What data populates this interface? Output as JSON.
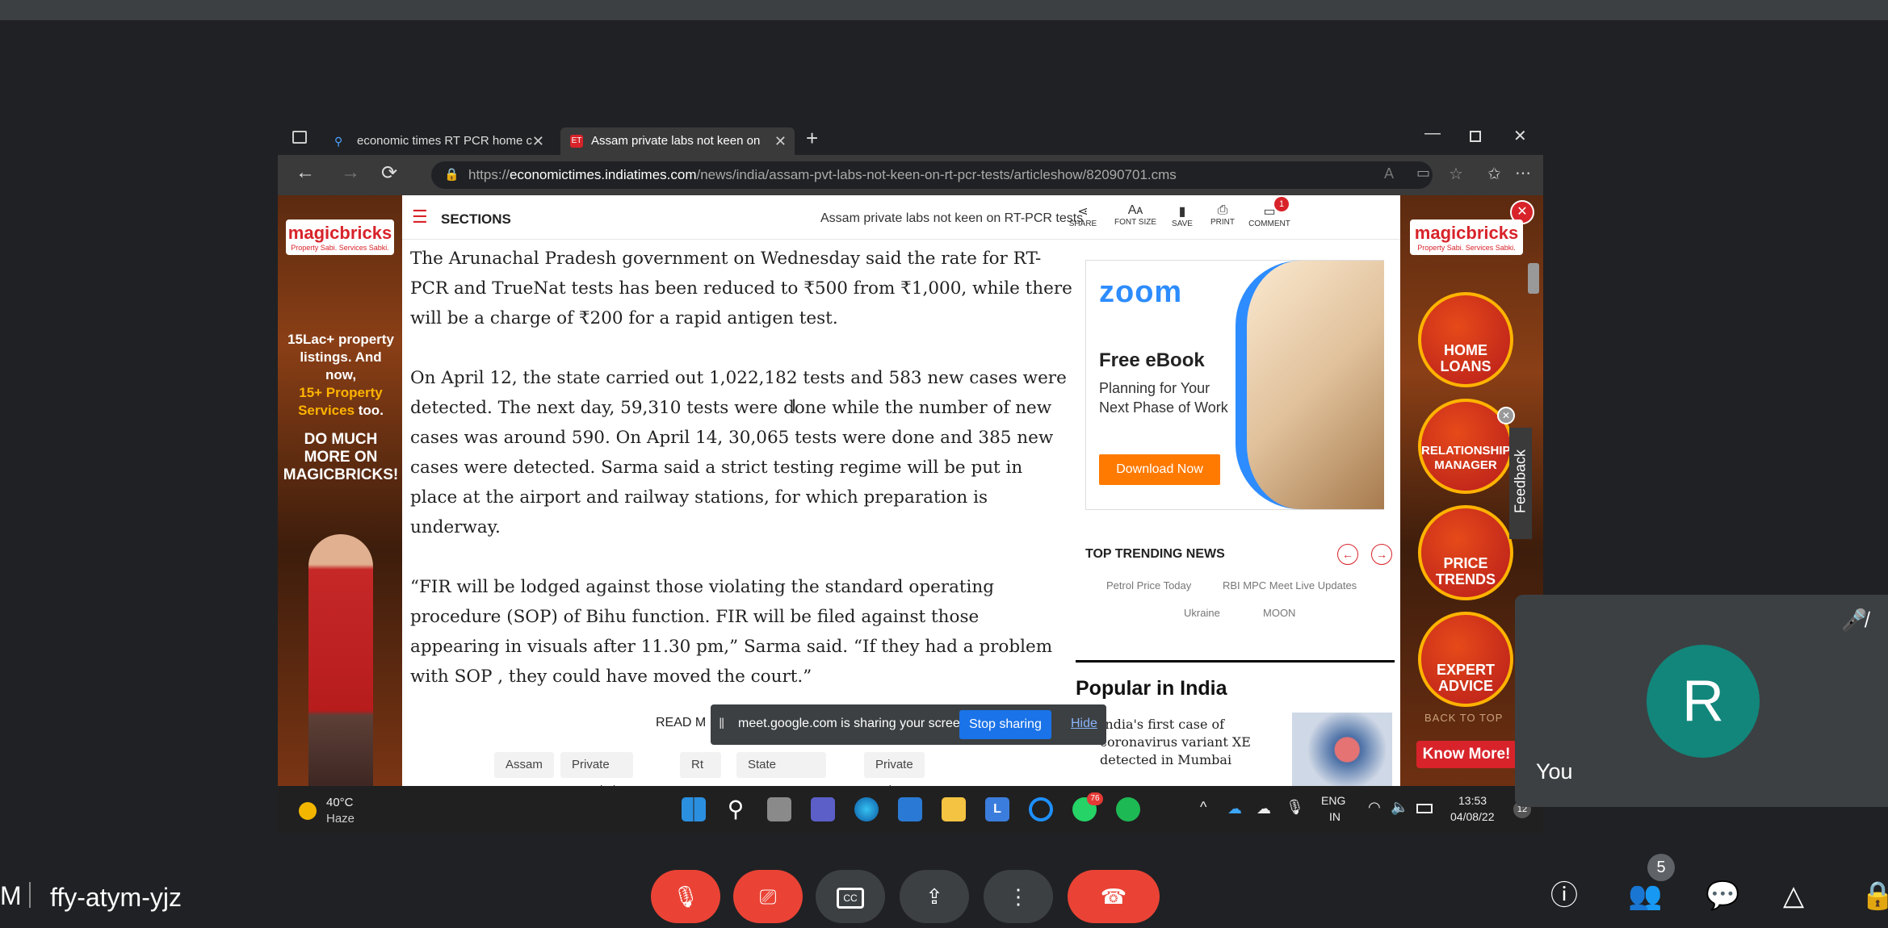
{
  "meeting": {
    "left_fragment": "M",
    "code": "ffy-atym-yjz",
    "participant_count": "5"
  },
  "browser": {
    "tabs": [
      {
        "label": "economic times RT PCR home c"
      },
      {
        "label": "Assam private labs not keen on"
      }
    ],
    "url_prefix": "https://",
    "url_domain": "economictimes.indiatimes.com",
    "url_path": "/news/india/assam-pvt-labs-not-keen-on-rt-pcr-tests/articleshow/82090701.cms"
  },
  "header": {
    "sections_label": "SECTIONS",
    "article_title": "Assam private labs not keen on RT-PCR tests",
    "actions": [
      "SHARE",
      "FONT SIZE",
      "SAVE",
      "PRINT",
      "COMMENT"
    ],
    "comment_count": "1"
  },
  "left_ad": {
    "brand": "magicbricks",
    "tagline": "Property Sabi. Services Sabki.",
    "text1": "15Lac+ property listings. And now,",
    "text2": "15+ Property Services",
    "text3": "too.",
    "text4": "DO MUCH MORE ON MAGICBRICKS!"
  },
  "right_ad": {
    "brand": "magicbricks",
    "tagline": "Property Sabi. Services Sabki.",
    "buttons": [
      "HOME LOANS",
      "RELATIONSHIP MANAGER",
      "PRICE TRENDS",
      "EXPERT ADVICE"
    ],
    "back_to_top": "BACK TO TOP",
    "cta": "Know More!",
    "feedback": "Feedback"
  },
  "article": {
    "paragraphs": [
      "The Arunachal Pradesh government on Wednesday said the rate for RT-PCR and TrueNat tests has been reduced to ₹500 from ₹1,000, while there will be a charge of ₹200 for a rapid antigen test.",
      "On April 12, the state carried out 1,022,182 tests and 583 new cases were detected. The next day, 59,310 tests were done while the number of new cases was around 590. On April 14, 30,065 tests were done and 385 new cases were detected. Sarma said a strict testing regime will be put in place at the airport and railway stations, for which preparation is underway.",
      "“FIR will be lodged against those violating the standard operating procedure (SOP) of Bihu function. FIR will be filed against those appearing in visuals after 11.30 pm,” Sarma said. “If they had a problem with SOP , they could have moved the court.”"
    ],
    "read_more": "READ M",
    "tags": [
      "Assam",
      "Private Hospitals",
      "Rt Pcr",
      "State Government",
      "Private Labs"
    ]
  },
  "zoom_ad": {
    "logo": "zoom",
    "title": "Free eBook",
    "subtitle": "Planning for Your Next Phase of Work",
    "cta": "Download Now"
  },
  "trending": {
    "title": "TOP TRENDING NEWS",
    "items": [
      "Petrol Price Today",
      "RBI MPC Meet Live Updates",
      "Ukraine",
      "MOON"
    ]
  },
  "popular": {
    "title": "Popular in India",
    "item": "India's first case of coronavirus variant XE detected in Mumbai"
  },
  "share_banner": {
    "text": "meet.google.com is sharing your screen.",
    "stop_label": "Stop sharing",
    "hide_label": "Hide"
  },
  "taskbar": {
    "temp": "40°C",
    "weather": "Haze",
    "lang1": "ENG",
    "lang2": "IN",
    "time": "13:53",
    "date": "04/08/22",
    "whatsapp_badge": "76",
    "notif_count": "12"
  },
  "self_view": {
    "initial": "R",
    "label": "You"
  },
  "colors": {
    "meet_bg": "#202124",
    "end_call": "#ea4335",
    "avatar": "#12867b",
    "stop_sharing": "#1a73e8",
    "zoom_blue": "#2d8cff"
  }
}
